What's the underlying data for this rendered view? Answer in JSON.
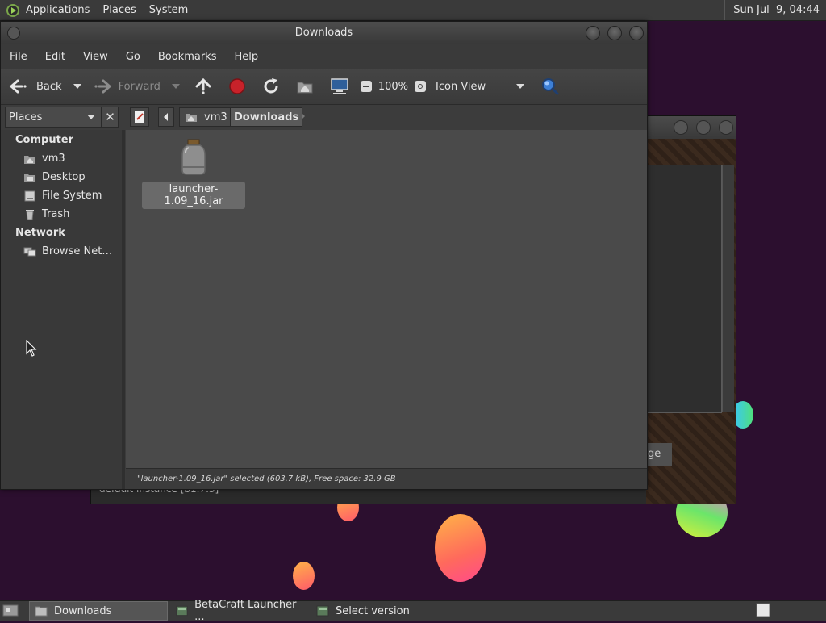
{
  "top_panel": {
    "menus": [
      "Applications",
      "Places",
      "System"
    ],
    "clock": "Sun Jul  9, 04:44"
  },
  "background_window": {
    "button_partial": "ge",
    "instance_text": "default instance [b1.7.3]"
  },
  "window": {
    "title": "Downloads",
    "menubar": [
      "File",
      "Edit",
      "View",
      "Go",
      "Bookmarks",
      "Help"
    ],
    "toolbar": {
      "back_label": "Back",
      "forward_label": "Forward",
      "zoom": "100%",
      "view_mode": "Icon View"
    },
    "sidebar": {
      "header": "Places",
      "sections": [
        {
          "title": "Computer",
          "items": [
            "vm3",
            "Desktop",
            "File System",
            "Trash"
          ]
        },
        {
          "title": "Network",
          "items": [
            "Browse Net…"
          ]
        }
      ]
    },
    "path": {
      "crumbs": [
        "vm3",
        "Downloads"
      ]
    },
    "files": [
      {
        "name": "launcher-1.09_16.jar",
        "icon": "jar-icon",
        "selected": true
      }
    ],
    "status": "\"launcher-1.09_16.jar\" selected (603.7 kB), Free space: 32.9 GB"
  },
  "taskbar": {
    "tasks": [
      "Downloads",
      "BetaCraft Launcher ...",
      "Select version"
    ]
  },
  "colors": {
    "desktop_bg": "#2c0f2f",
    "panel": "#3a3a3a",
    "content": "#4a4a4a",
    "stop_red": "#c8222a",
    "zoom_blue": "#3d7fd6"
  }
}
